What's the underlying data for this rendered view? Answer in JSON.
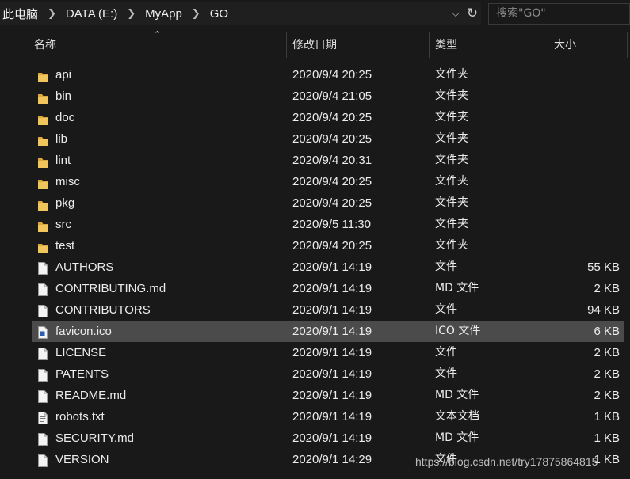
{
  "breadcrumb": [
    "此电脑",
    "DATA (E:)",
    "MyApp",
    "GO"
  ],
  "search": {
    "placeholder": "搜索\"GO\""
  },
  "columns": {
    "name": "名称",
    "date": "修改日期",
    "type": "类型",
    "size": "大小"
  },
  "files": [
    {
      "name": "api",
      "date": "2020/9/4 20:25",
      "type": "文件夹",
      "size": "",
      "kind": "folder"
    },
    {
      "name": "bin",
      "date": "2020/9/4 21:05",
      "type": "文件夹",
      "size": "",
      "kind": "folder"
    },
    {
      "name": "doc",
      "date": "2020/9/4 20:25",
      "type": "文件夹",
      "size": "",
      "kind": "folder"
    },
    {
      "name": "lib",
      "date": "2020/9/4 20:25",
      "type": "文件夹",
      "size": "",
      "kind": "folder"
    },
    {
      "name": "lint",
      "date": "2020/9/4 20:31",
      "type": "文件夹",
      "size": "",
      "kind": "folder"
    },
    {
      "name": "misc",
      "date": "2020/9/4 20:25",
      "type": "文件夹",
      "size": "",
      "kind": "folder"
    },
    {
      "name": "pkg",
      "date": "2020/9/4 20:25",
      "type": "文件夹",
      "size": "",
      "kind": "folder"
    },
    {
      "name": "src",
      "date": "2020/9/5 11:30",
      "type": "文件夹",
      "size": "",
      "kind": "folder"
    },
    {
      "name": "test",
      "date": "2020/9/4 20:25",
      "type": "文件夹",
      "size": "",
      "kind": "folder"
    },
    {
      "name": "AUTHORS",
      "date": "2020/9/1 14:19",
      "type": "文件",
      "size": "55 KB",
      "kind": "file"
    },
    {
      "name": "CONTRIBUTING.md",
      "date": "2020/9/1 14:19",
      "type": "MD 文件",
      "size": "2 KB",
      "kind": "file"
    },
    {
      "name": "CONTRIBUTORS",
      "date": "2020/9/1 14:19",
      "type": "文件",
      "size": "94 KB",
      "kind": "file"
    },
    {
      "name": "favicon.ico",
      "date": "2020/9/1 14:19",
      "type": "ICO 文件",
      "size": "6 KB",
      "kind": "ico",
      "selected": true
    },
    {
      "name": "LICENSE",
      "date": "2020/9/1 14:19",
      "type": "文件",
      "size": "2 KB",
      "kind": "file"
    },
    {
      "name": "PATENTS",
      "date": "2020/9/1 14:19",
      "type": "文件",
      "size": "2 KB",
      "kind": "file"
    },
    {
      "name": "README.md",
      "date": "2020/9/1 14:19",
      "type": "MD 文件",
      "size": "2 KB",
      "kind": "file"
    },
    {
      "name": "robots.txt",
      "date": "2020/9/1 14:19",
      "type": "文本文档",
      "size": "1 KB",
      "kind": "textfile"
    },
    {
      "name": "SECURITY.md",
      "date": "2020/9/1 14:19",
      "type": "MD 文件",
      "size": "1 KB",
      "kind": "file"
    },
    {
      "name": "VERSION",
      "date": "2020/9/1 14:29",
      "type": "文件",
      "size": "1 KB",
      "kind": "file"
    }
  ],
  "watermark": "https://blog.csdn.net/try17875864815",
  "colors": {
    "background": "#191919",
    "selection": "#4b4b4b",
    "folder": "#e8b84a",
    "text": "#ececec"
  }
}
